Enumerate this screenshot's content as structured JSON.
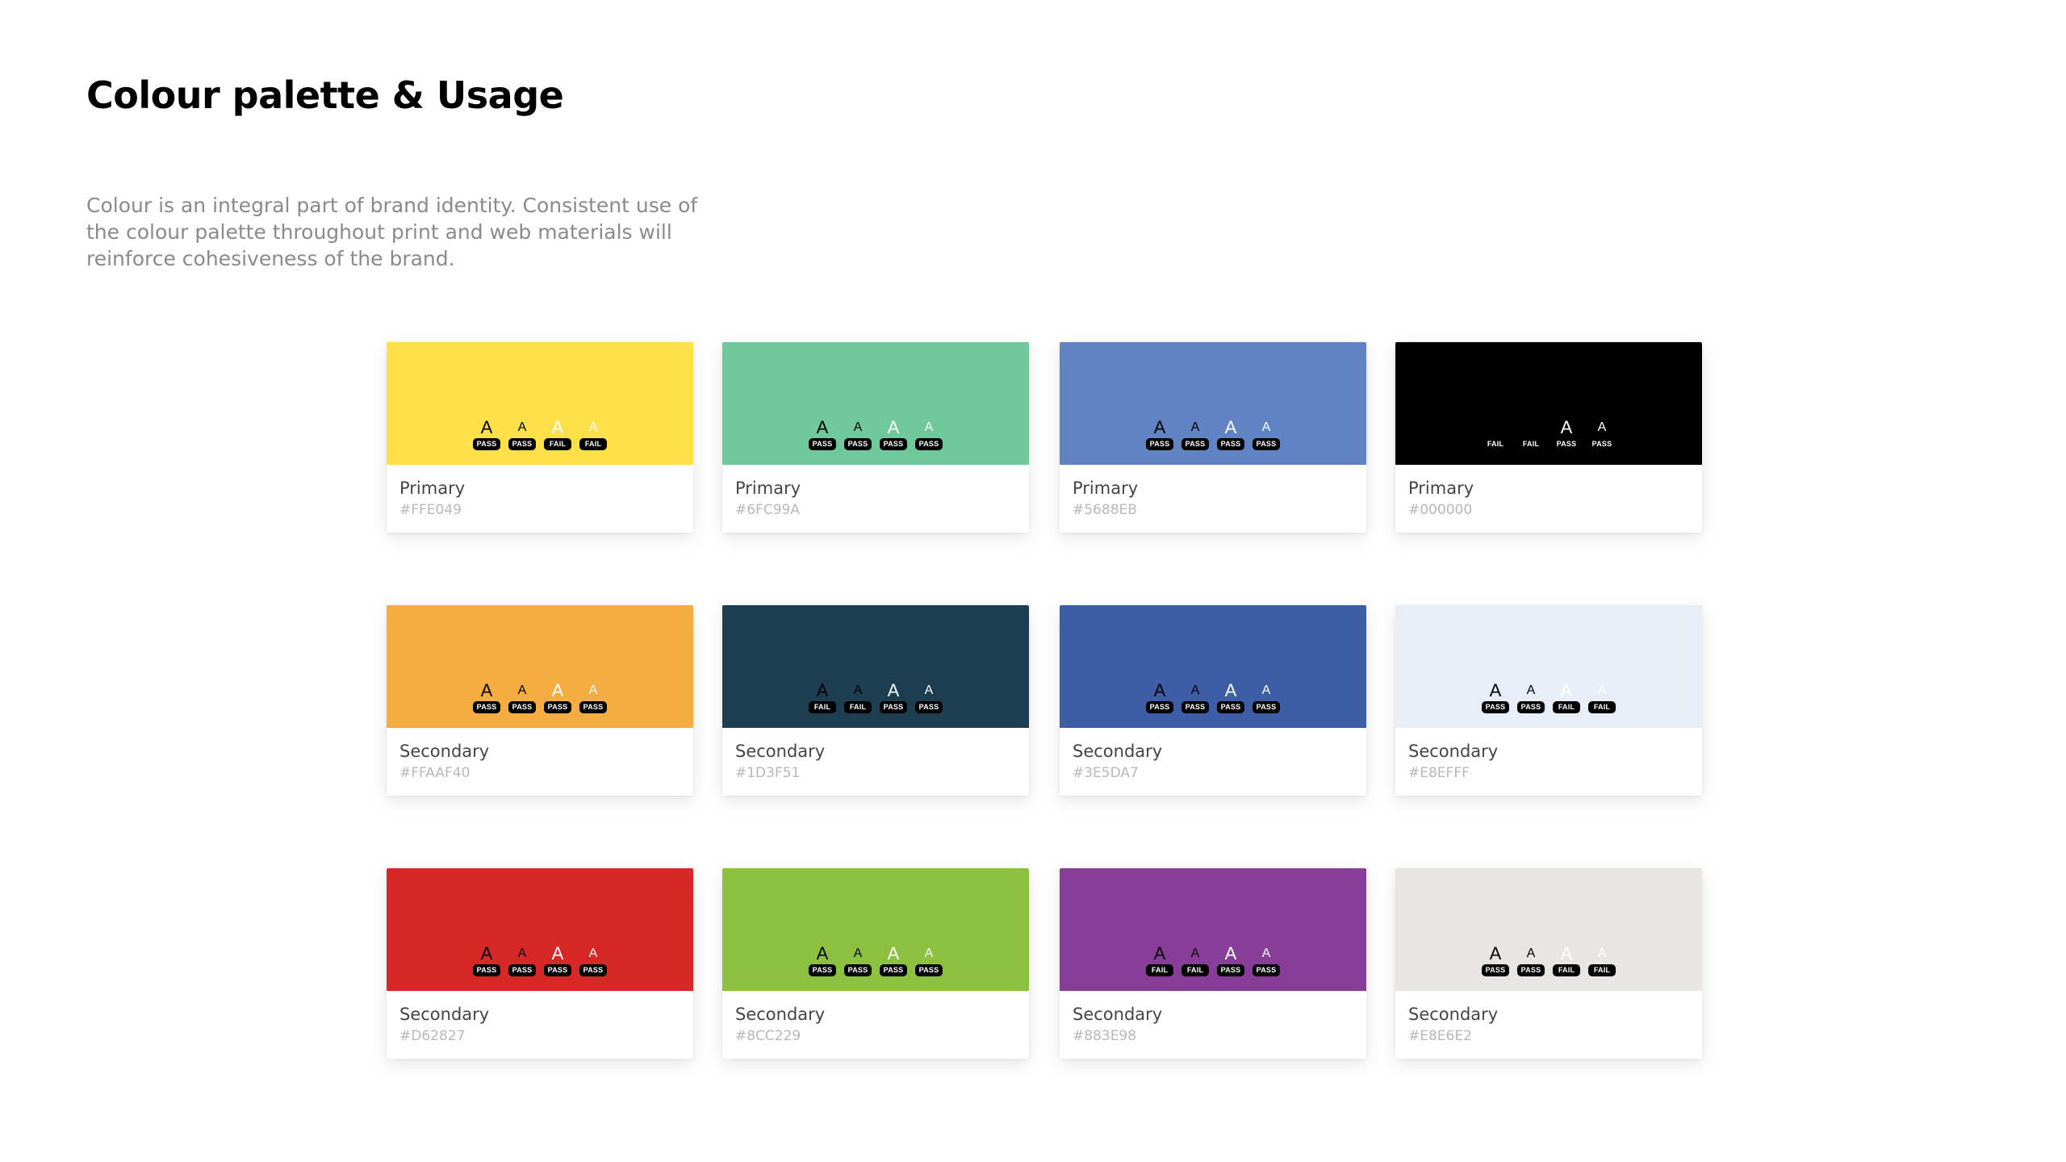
{
  "page": {
    "title": "Colour palette & Usage",
    "intro": "Colour is an integral part of brand identity. Consistent use of the colour palette throughout print and web materials will reinforce cohesiveness of the brand."
  },
  "swatches": [
    {
      "label": "Primary",
      "hex": "#FFE049",
      "color": "#FFE049",
      "tests": [
        "PASS",
        "PASS",
        "FAIL",
        "FAIL"
      ]
    },
    {
      "label": "Primary",
      "hex": "#6FC99A",
      "color": "#6FC99A",
      "tests": [
        "PASS",
        "PASS",
        "PASS",
        "PASS"
      ]
    },
    {
      "label": "Primary",
      "hex": "#5688EB",
      "color": "#6083C4",
      "tests": [
        "PASS",
        "PASS",
        "PASS",
        "PASS"
      ]
    },
    {
      "label": "Primary",
      "hex": "#000000",
      "color": "#000000",
      "tests": [
        "FAIL",
        "FAIL",
        "PASS",
        "PASS"
      ]
    },
    {
      "label": "Secondary",
      "hex": "#FFAAF40",
      "color": "#F5AD41",
      "tests": [
        "PASS",
        "PASS",
        "PASS",
        "PASS"
      ]
    },
    {
      "label": "Secondary",
      "hex": "#1D3F51",
      "color": "#1D3D51",
      "tests": [
        "FAIL",
        "FAIL",
        "PASS",
        "PASS"
      ]
    },
    {
      "label": "Secondary",
      "hex": "#3E5DA7",
      "color": "#3E5DA7",
      "tests": [
        "PASS",
        "PASS",
        "PASS",
        "PASS"
      ]
    },
    {
      "label": "Secondary",
      "hex": "#E8EFFF",
      "color": "#E8EEF8",
      "tests": [
        "PASS",
        "PASS",
        "FAIL",
        "FAIL"
      ]
    },
    {
      "label": "Secondary",
      "hex": "#D62827",
      "color": "#D62827",
      "tests": [
        "PASS",
        "PASS",
        "PASS",
        "PASS"
      ]
    },
    {
      "label": "Secondary",
      "hex": "#8CC229",
      "color": "#8CC13F",
      "tests": [
        "PASS",
        "PASS",
        "PASS",
        "PASS"
      ]
    },
    {
      "label": "Secondary",
      "hex": "#883E98",
      "color": "#883E98",
      "tests": [
        "FAIL",
        "FAIL",
        "PASS",
        "PASS"
      ]
    },
    {
      "label": "Secondary",
      "hex": "#E8E6E2",
      "color": "#E8E6E2",
      "tests": [
        "PASS",
        "PASS",
        "FAIL",
        "FAIL"
      ]
    }
  ],
  "colors": {
    "title": "#000000",
    "intro": "#8A8A8A",
    "label": "#444444",
    "hex": "#B8B8B8",
    "badge": "#000000"
  }
}
